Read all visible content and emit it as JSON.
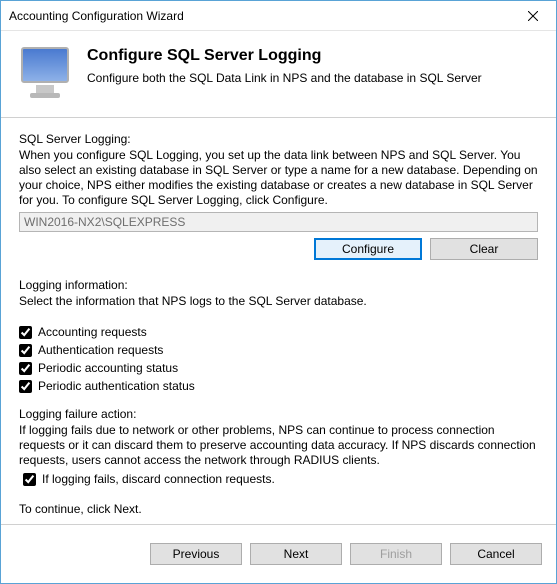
{
  "titlebar": {
    "title": "Accounting Configuration Wizard"
  },
  "header": {
    "heading": "Configure SQL Server Logging",
    "subheading": "Configure both the SQL Data Link in NPS and the database in SQL Server"
  },
  "sql_logging": {
    "label": "SQL Server Logging:",
    "description": "When you configure SQL Logging, you set up the data link between NPS and SQL Server. You also select an existing database in SQL Server or type a name for a new database. Depending on your choice, NPS either modifies the existing database or creates a new database in SQL Server for you. To configure SQL Server Logging, click Configure.",
    "server_value": "WIN2016-NX2\\SQLEXPRESS",
    "configure_label": "Configure",
    "clear_label": "Clear"
  },
  "logging_info": {
    "label": "Logging information:",
    "description": "Select the information that NPS logs to the SQL Server database.",
    "checkboxes": [
      {
        "label": "Accounting requests",
        "checked": true
      },
      {
        "label": "Authentication requests",
        "checked": true
      },
      {
        "label": "Periodic accounting status",
        "checked": true
      },
      {
        "label": "Periodic authentication status",
        "checked": true
      }
    ]
  },
  "failure": {
    "label": "Logging failure action:",
    "description": "If logging fails due to network or other problems, NPS can continue to process connection requests or it can discard them to preserve accounting data accuracy. If NPS discards connection requests, users cannot access the network through RADIUS clients.",
    "checkbox_label": "If logging fails, discard connection requests.",
    "checkbox_checked": true
  },
  "continue_text": "To continue, click Next.",
  "footer": {
    "previous": "Previous",
    "next": "Next",
    "finish": "Finish",
    "cancel": "Cancel"
  }
}
